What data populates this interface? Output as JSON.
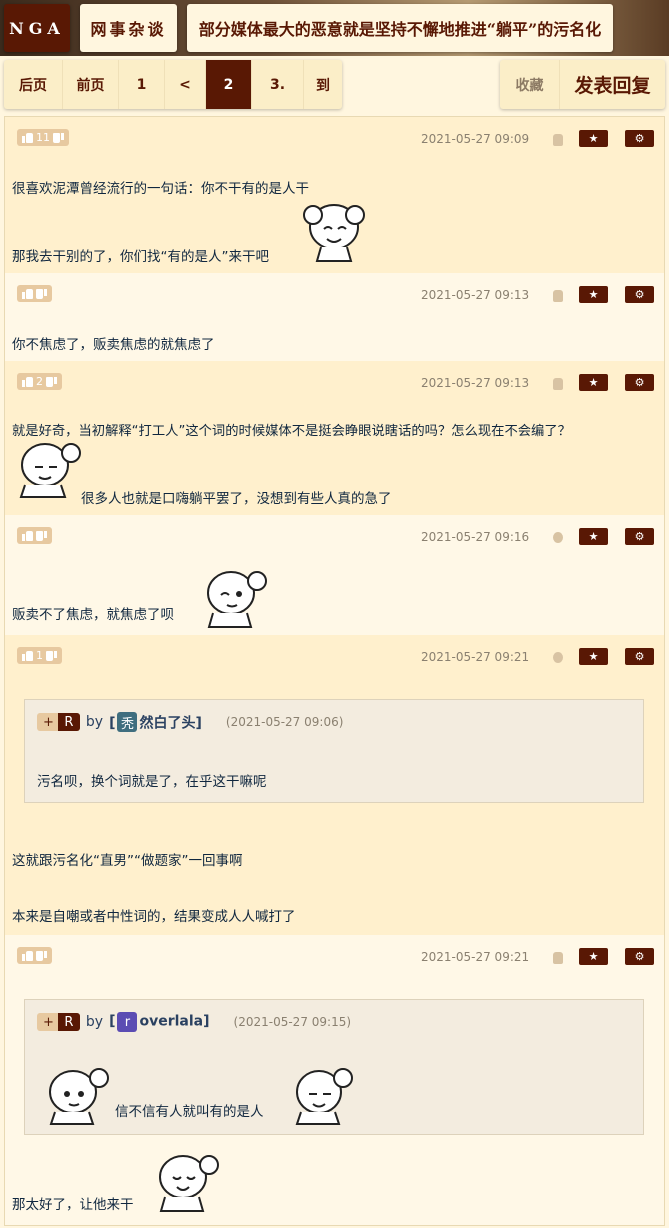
{
  "header": {
    "logo": "NGA",
    "forum": "网事杂谈",
    "title": "部分媒体最大的恶意就是坚持不懈地推进“躺平”的污名化"
  },
  "pager": {
    "items": [
      {
        "label": "后页",
        "w": 59
      },
      {
        "label": "前页",
        "w": 56
      },
      {
        "label": "1",
        "w": 46
      },
      {
        "label": "<",
        "w": 41
      },
      {
        "label": "2",
        "w": 46,
        "active": true
      },
      {
        "label": "3.",
        "w": 52
      },
      {
        "label": "到",
        "w": 38
      }
    ]
  },
  "actions": {
    "favorite": "收藏",
    "reply": "发表回复"
  },
  "colors": {
    "brand": "#591804",
    "bg": "#fff6df",
    "post_odd": "#fff0cd",
    "post_even": "#fff8e7"
  },
  "posts": [
    {
      "votes": "11",
      "time": "2021-05-27 09:09",
      "device": "android",
      "lines": [
        "很喜欢泥潭曾经流行的一句话：你不干有的是人干",
        "那我去干别的了，你们找“有的是人”来干吧"
      ]
    },
    {
      "votes": "",
      "time": "2021-05-27 09:13",
      "device": "android",
      "lines": [
        "你不焦虑了，贩卖焦虑的就焦虑了"
      ]
    },
    {
      "votes": "2",
      "time": "2021-05-27 09:13",
      "device": "android",
      "lines": [
        "就是好奇，当初解释“打工人”这个词的时候媒体不是挺会睁眼说瞎话的吗？怎么现在不会编了？",
        "很多人也就是口嗨躺平罢了，没想到有些人真的急了"
      ]
    },
    {
      "votes": "",
      "time": "2021-05-27 09:16",
      "device": "apple",
      "lines": [
        "贩卖不了焦虑，就焦虑了呗"
      ]
    },
    {
      "votes": "1",
      "time": "2021-05-27 09:21",
      "device": "apple",
      "quote": {
        "plus": "+",
        "r": "R",
        "by": "by",
        "user": "然白了头]",
        "avatar": "秃",
        "avatar_color": "#3f6e7f",
        "time": "(2021-05-27 09:06)",
        "text": "污名呗，换个词就是了，在乎这干嘛呢"
      },
      "lines": [
        "这就跟污名化“直男”“做题家”一回事啊",
        "本来是自嘲或者中性词的，结果变成人人喊打了"
      ]
    },
    {
      "votes": "",
      "time": "2021-05-27 09:21",
      "device": "android",
      "quote": {
        "plus": "+",
        "r": "R",
        "by": "by",
        "user": "overlala]",
        "avatar": "r",
        "avatar_color": "#5b4cb3",
        "time": "(2021-05-27 09:15)",
        "text": "信不信有人就叫有的是人"
      },
      "lines": [
        "那太好了，让他来干"
      ]
    }
  ]
}
